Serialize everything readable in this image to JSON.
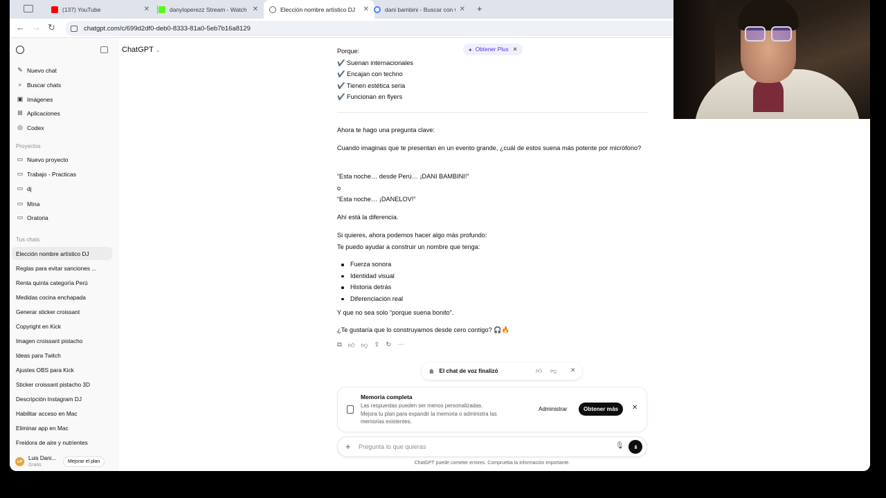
{
  "browser": {
    "tabs": [
      {
        "title": "(137) YouTube",
        "favicon_color": "#ff0000",
        "active": false
      },
      {
        "title": "danyloperezz Stream - Watch",
        "favicon_color": "#53fc18",
        "active": false
      },
      {
        "title": "Elección nombre artístico DJ",
        "favicon_color": "#5f6368",
        "active": true
      },
      {
        "title": "dani bambini - Buscar con Go",
        "favicon_color": "#4285f4",
        "active": false
      }
    ],
    "url": "chatgpt.com/c/699d2df0-deb0-8333-81a0-5eb7b16a8129"
  },
  "sidebar": {
    "top_items": [
      {
        "label": "Nuevo chat",
        "icon": "new-chat-icon"
      },
      {
        "label": "Buscar chats",
        "icon": "search-icon"
      },
      {
        "label": "Imágenes",
        "icon": "image-icon"
      },
      {
        "label": "Aplicaciones",
        "icon": "apps-icon"
      },
      {
        "label": "Codex",
        "icon": "codex-icon"
      }
    ],
    "projects_header": "Proyectos",
    "projects": [
      {
        "label": "Nuevo proyecto",
        "icon": "new-folder-icon"
      },
      {
        "label": "Trabajo - Practicas",
        "icon": "folder-icon"
      },
      {
        "label": "dj",
        "icon": "folder-icon"
      },
      {
        "label": "Mina",
        "icon": "folder-icon"
      },
      {
        "label": "Oratoria",
        "icon": "folder-icon"
      }
    ],
    "chats_header": "Tus chats",
    "chats": [
      "Elección nombre artístico DJ",
      "Reglas para evitar sanciones ...",
      "Renta quinta categoría Perú",
      "Medidas cocina enchapada",
      "Generar sticker croissant",
      "Copyright en Kick",
      "Imagen croissant pistacho",
      "Ideas para Twitch",
      "Ajustes OBS para Kick",
      "Sticker croissant pistacho 3D",
      "Descripción Instagram DJ",
      "Habilitar acceso en Mac",
      "Eliminar app en Mac",
      "Freidora de aire y nutrientes"
    ],
    "user": {
      "initials": "LP",
      "name": "Luis Dani...",
      "plan": "Gratis",
      "upgrade": "Mejorar el plan"
    }
  },
  "header": {
    "model": "ChatGPT",
    "plus_pill": "Obtener Plus"
  },
  "conversation": {
    "porque": "Porque:",
    "checks": [
      "Suenan internacionales",
      "Encajan con techno",
      "Tienen estética seria",
      "Funcionan en flyers"
    ],
    "p1": "Ahora te hago una pregunta clave:",
    "p2": "Cuando imaginas que te presentan en un evento grande, ¿cuál de estos suena más potente por micrófono?",
    "quote1": "“Esta noche… desde Perú… ¡DANI BAMBINI!”",
    "or": "o",
    "quote2": "“Esta noche… ¡DANELOV!”",
    "p3": "Ahí está la diferencia.",
    "p4a": "Si quieres, ahora podemos hacer algo más profundo:",
    "p4b": "Te puedo ayudar a construir un nombre que tenga:",
    "bullets": [
      "Fuerza sonora",
      "Identidad visual",
      "Historia detrás",
      "Diferenciación real"
    ],
    "p5": "Y que no sea solo “porque suena bonito”.",
    "p6": "¿Te gustaría que lo construyamos desde cero contigo? 🎧🔥"
  },
  "voice_banner": {
    "text": "El chat de voz finalizó"
  },
  "memory_card": {
    "title": "Memoria completa",
    "line1": "Las respuestas pueden ser menos personalizadas.",
    "line2": "Mejora tu plan para expandir la memoria o administra las memorias existentes.",
    "manage": "Administrar",
    "get_more": "Obtener más"
  },
  "composer": {
    "placeholder": "Pregunta lo que quieras",
    "disclaimer": "ChatGPT puede cometer errores. Comprueba la información importante."
  }
}
